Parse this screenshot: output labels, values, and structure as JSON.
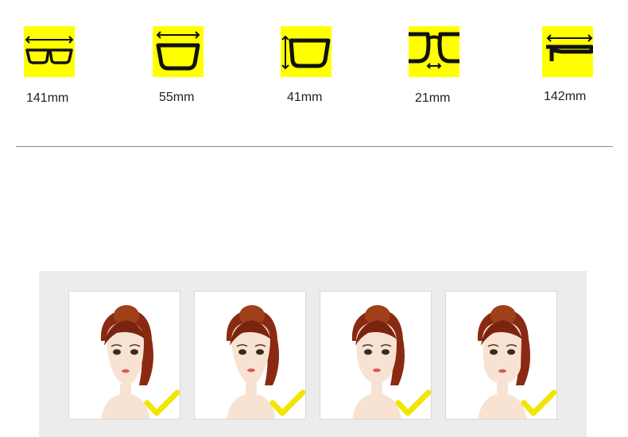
{
  "specs": [
    {
      "name": "frame-width",
      "value": "141mm",
      "icon": "frame-width-icon"
    },
    {
      "name": "lens-width",
      "value": "55mm",
      "icon": "lens-width-icon"
    },
    {
      "name": "lens-height",
      "value": "41mm",
      "icon": "lens-height-icon"
    },
    {
      "name": "bridge-width",
      "value": "21mm",
      "icon": "bridge-width-icon"
    },
    {
      "name": "temple-length",
      "value": "142mm",
      "icon": "temple-length-icon"
    }
  ],
  "faces": [
    {
      "shape": "oval-face",
      "suitable": true
    },
    {
      "shape": "heart-face",
      "suitable": true
    },
    {
      "shape": "round-face",
      "suitable": true
    },
    {
      "shape": "square-face",
      "suitable": true
    }
  ],
  "colors": {
    "tile": "#ffff00",
    "icon_stroke": "#111111",
    "panel": "#ececec",
    "check": "#f2e600"
  }
}
